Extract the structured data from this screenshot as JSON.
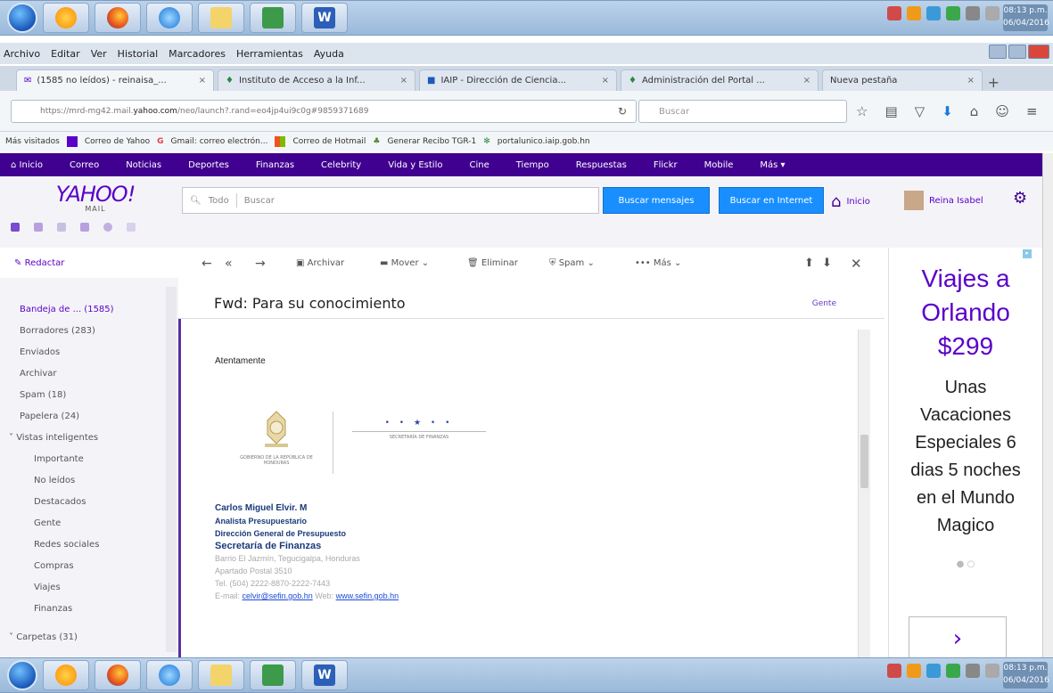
{
  "taskbar": {
    "clock_time": "08:13 p.m.",
    "clock_date": "06/04/2016"
  },
  "menubar": [
    "Archivo",
    "Editar",
    "Ver",
    "Historial",
    "Marcadores",
    "Herramientas",
    "Ayuda"
  ],
  "tabs": [
    {
      "label": "(1585 no leídos) - reinaisa_..."
    },
    {
      "label": "Instituto de Acceso a la Inf..."
    },
    {
      "label": "IAIP - Dirección de Ciencia..."
    },
    {
      "label": "Administración del Portal ..."
    },
    {
      "label": "Nueva pestaña"
    }
  ],
  "navbar": {
    "url_prefix": "https://mrd-mg42.mail.",
    "url_domain": "yahoo.com",
    "url_suffix": "/neo/launch?.rand=eo4jp4ui9c0g#9859371689",
    "search_placeholder": "Buscar"
  },
  "bookmarks": [
    "Más visitados",
    "Correo de Yahoo",
    "Gmail: correo electrón...",
    "Correo de Hotmail",
    "Generar Recibo TGR-1",
    "portalunico.iaip.gob.hn"
  ],
  "yahoo_nav": [
    "Inicio",
    "Correo",
    "Noticias",
    "Deportes",
    "Finanzas",
    "Celebrity",
    "Vida y Estilo",
    "Cine",
    "Tiempo",
    "Respuestas",
    "Flickr",
    "Mobile",
    "Más"
  ],
  "yahoo": {
    "logo": "YAHOO!",
    "logo_sub": "MAIL",
    "search_scope": "Todo",
    "search_placeholder": "Buscar",
    "btn_search_mail": "Buscar mensajes",
    "btn_search_web": "Buscar en Internet",
    "home_label": "Inicio",
    "user_name": "Reina Isabel"
  },
  "toolbar": {
    "compose": "Redactar",
    "archive": "Archivar",
    "move": "Mover",
    "delete": "Eliminar",
    "spam": "Spam",
    "more": "Más"
  },
  "sidebar": [
    {
      "label": "Bandeja de ... (1585)"
    },
    {
      "label": "Borradores (283)"
    },
    {
      "label": "Enviados"
    },
    {
      "label": "Archivar"
    },
    {
      "label": "Spam (18)"
    },
    {
      "label": "Papelera (24)"
    },
    {
      "label": "Vistas inteligentes"
    },
    {
      "label": "Importante"
    },
    {
      "label": "No leídos"
    },
    {
      "label": "Destacados"
    },
    {
      "label": "Gente"
    },
    {
      "label": "Redes sociales"
    },
    {
      "label": "Compras"
    },
    {
      "label": "Viajes"
    },
    {
      "label": "Finanzas"
    },
    {
      "label": "Carpetas (31)"
    }
  ],
  "message": {
    "subject": "Fwd: Para su conocimiento",
    "people_label": "Gente",
    "closing": "Atentamente",
    "logo_left_text": "GOBIERNO DE LA REPÚBLICA DE HONDURAS",
    "logo_right_text": "SECRETARÍA DE FINANZAS",
    "sig_name": "Carlos Miguel Elvir. M",
    "sig_title": "Analista Presupuestario",
    "sig_dept": "Dirección General de Presupuesto",
    "sig_org": "Secretaría de Finanzas",
    "sig_addr": "Barrio El Jazmín, Tegucigalpa, Honduras",
    "sig_po": "Apartado Postal 3510",
    "sig_tel": "Tel. (504) 2222-8870-2222-7443",
    "sig_email_label": "E-mail:",
    "sig_email": "celvir@sefin.gob.hn",
    "sig_web_label": "Web:",
    "sig_web": "www.sefin.gob.hn"
  },
  "ad": {
    "title1": "Viajes a",
    "title2": "Orlando",
    "price": "$299",
    "body": [
      "Unas",
      "Vacaciones",
      "Especiales 6",
      "dias 5 noches",
      "en el Mundo",
      "Magico"
    ]
  }
}
